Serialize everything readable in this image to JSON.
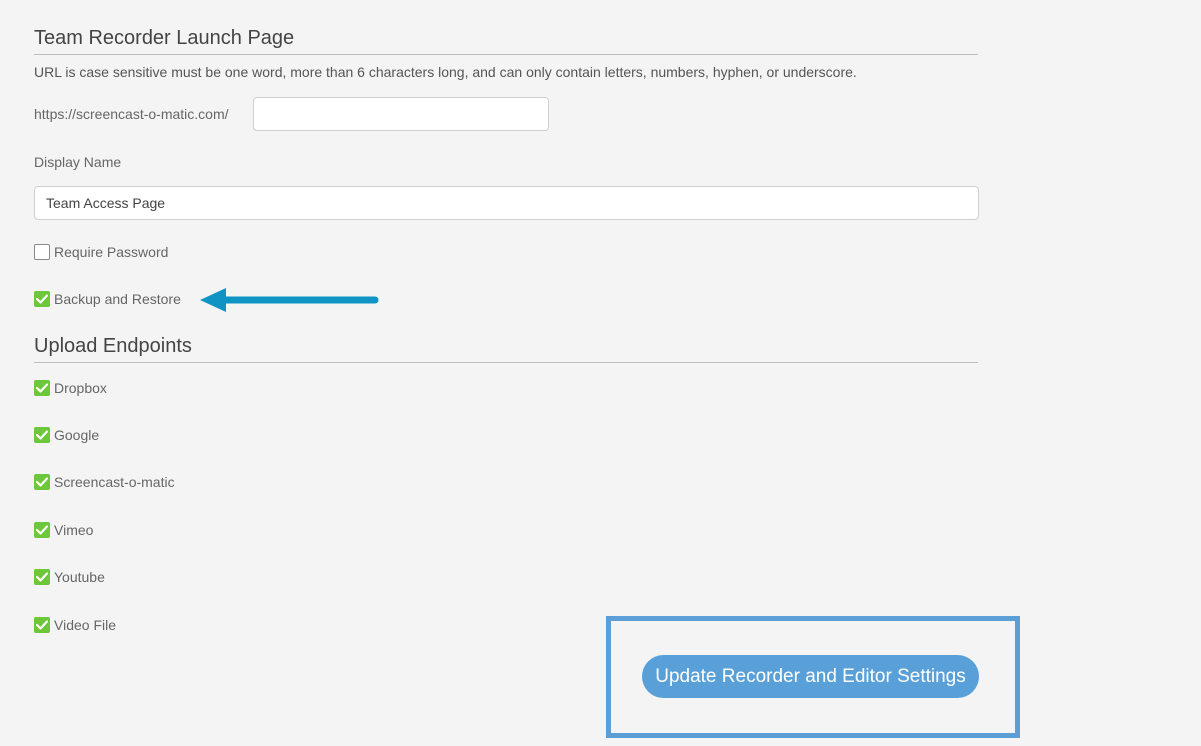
{
  "launch_section": {
    "title": "Team Recorder Launch Page",
    "help_text": "URL is case sensitive must be one word, more than 6 characters long, and can only contain letters, numbers, hyphen, or underscore.",
    "url_prefix": "https://screencast-o-matic.com/",
    "url_value": "",
    "display_name_label": "Display Name",
    "display_name_value": "Team Access Page"
  },
  "options": {
    "require_password": {
      "label": "Require Password",
      "checked": false
    },
    "backup_restore": {
      "label": "Backup and Restore",
      "checked": true
    }
  },
  "endpoints_section": {
    "title": "Upload Endpoints",
    "items": [
      {
        "label": "Dropbox",
        "checked": true
      },
      {
        "label": "Google",
        "checked": true
      },
      {
        "label": "Screencast-o-matic",
        "checked": true
      },
      {
        "label": "Vimeo",
        "checked": true
      },
      {
        "label": "Youtube",
        "checked": true
      },
      {
        "label": "Video File",
        "checked": true
      }
    ]
  },
  "actions": {
    "update_label": "Update Recorder and Editor Settings"
  },
  "colors": {
    "check_green": "#6dc73a",
    "button_blue": "#5aa0d8",
    "arrow_blue": "#0f94c4",
    "highlight_border": "#5b9fd6"
  },
  "icons": {
    "checked": "check-icon",
    "annotation": "arrow-left-icon"
  }
}
